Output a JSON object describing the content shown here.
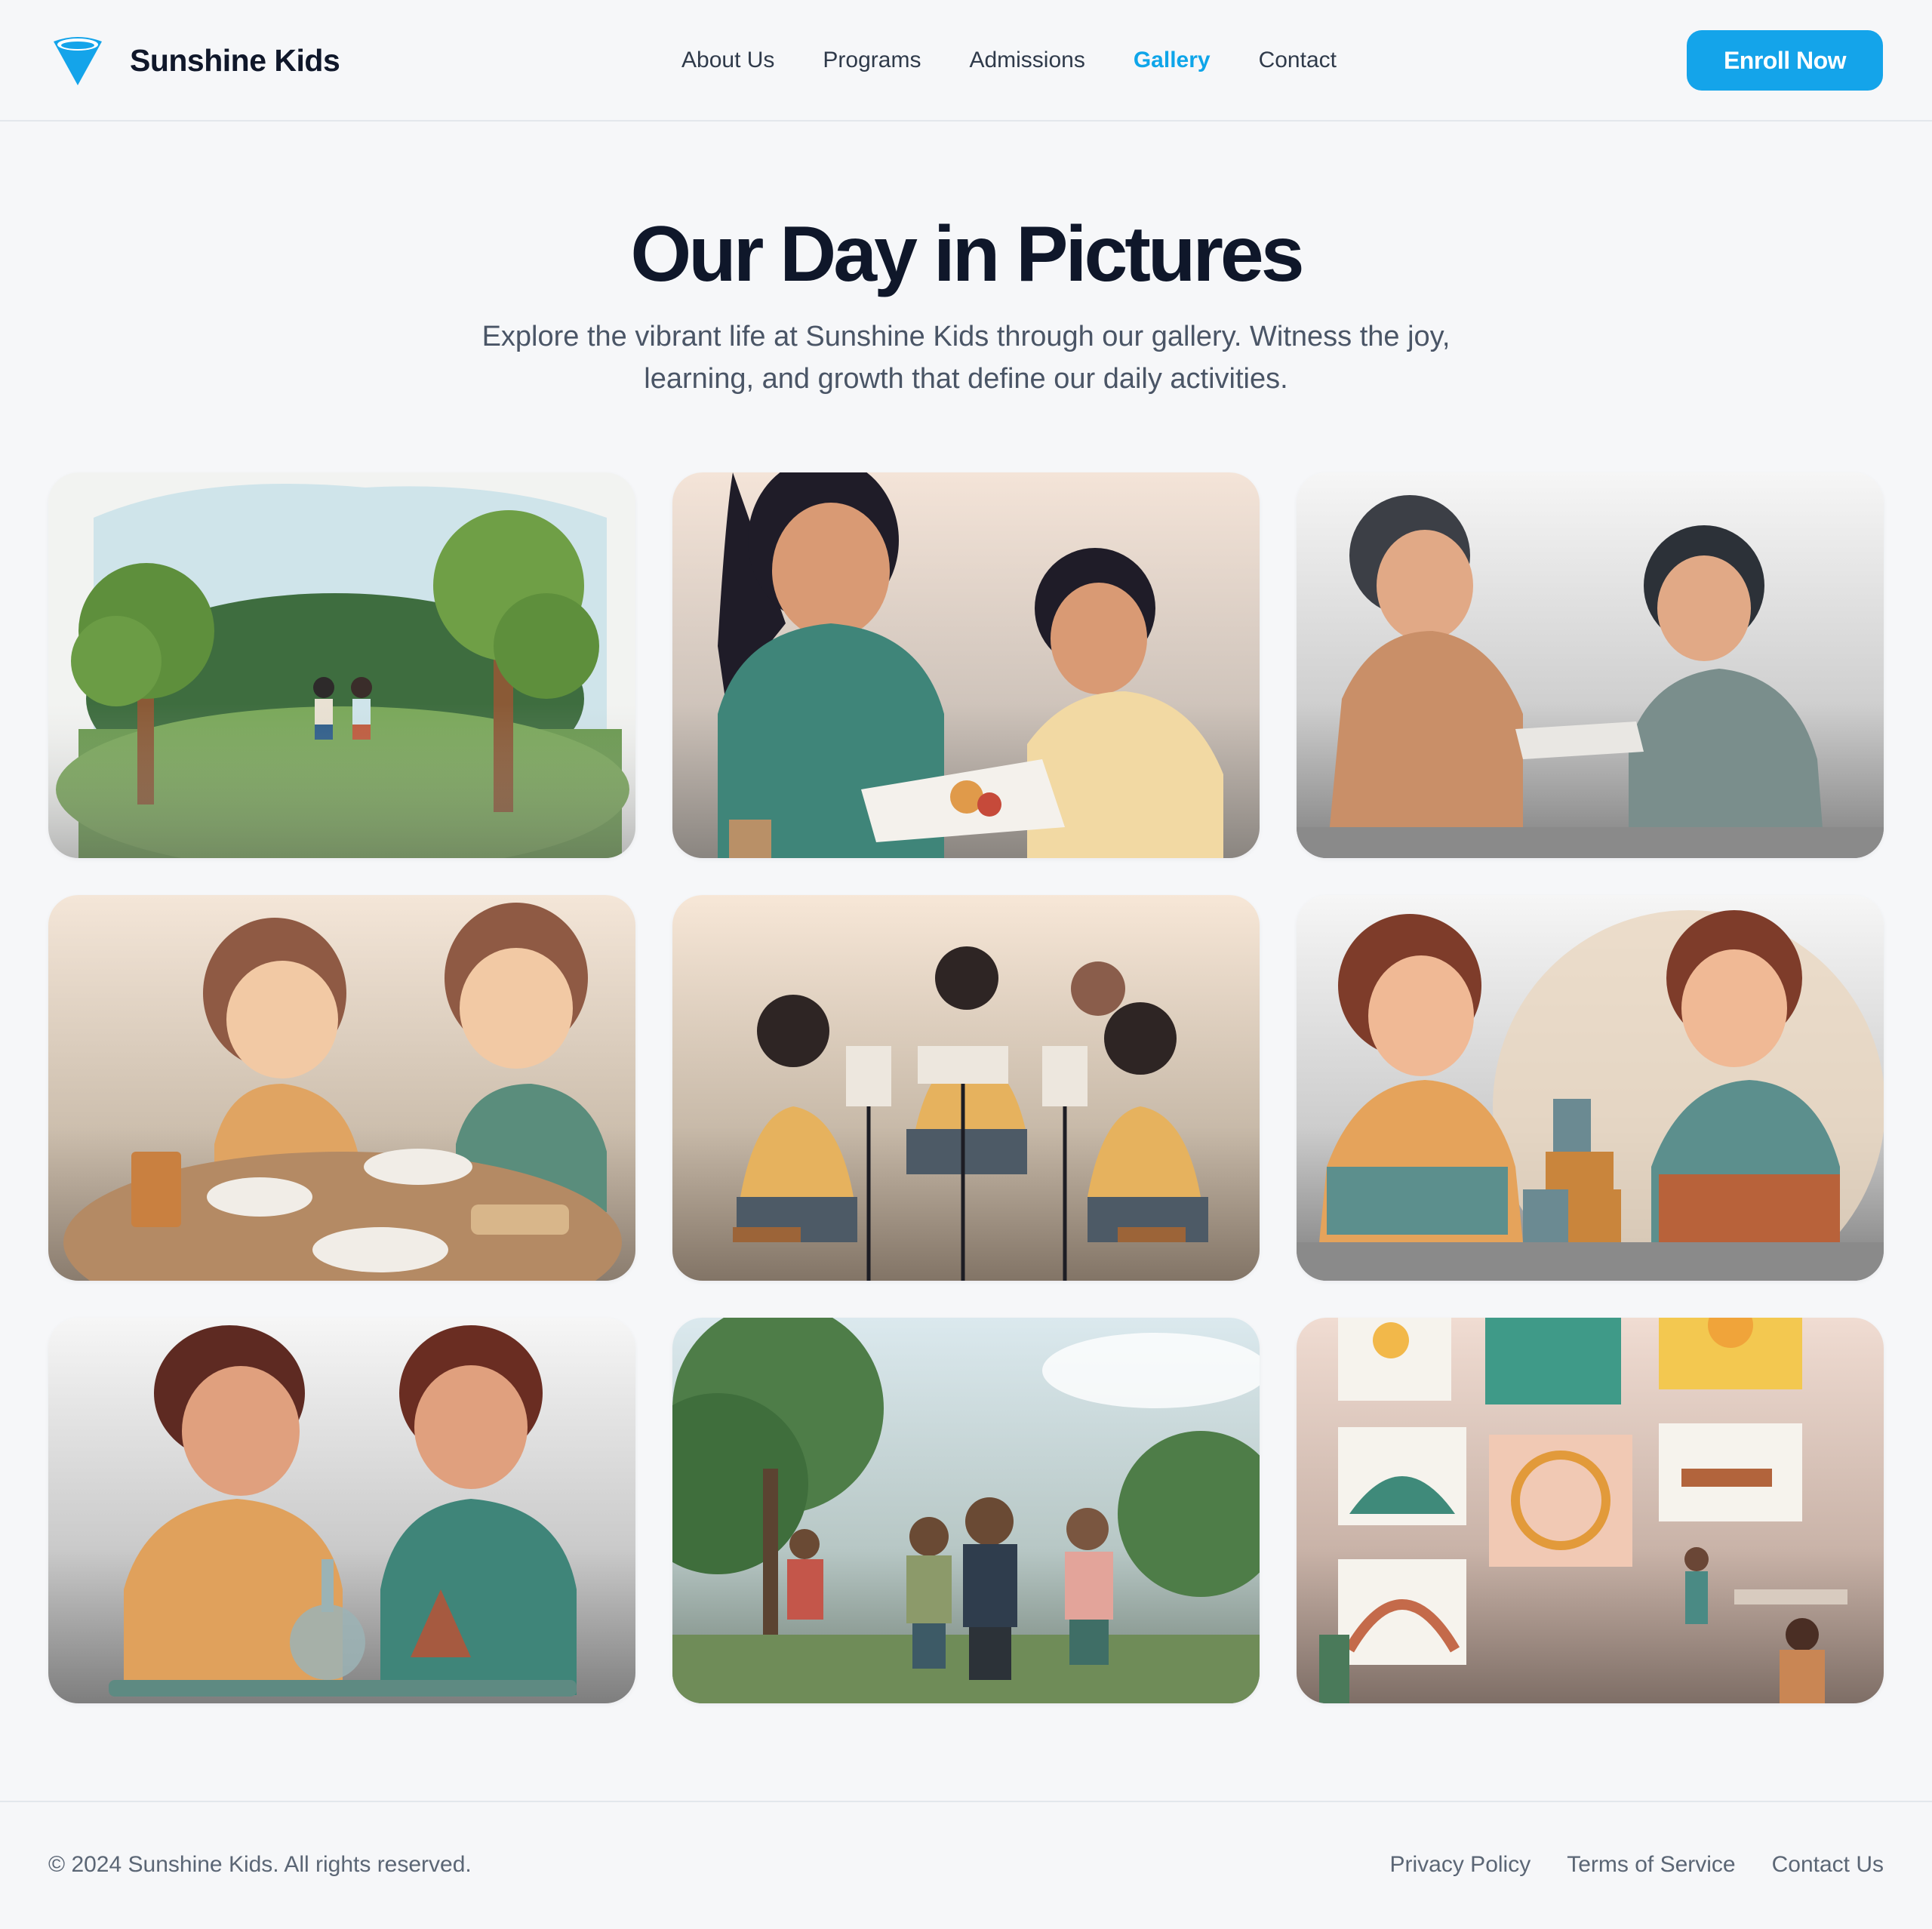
{
  "brand": {
    "name": "Sunshine Kids",
    "logo_icon": "funnel-logo-icon",
    "accent": "#14a4ea"
  },
  "nav": {
    "items": [
      {
        "label": "About Us",
        "active": false
      },
      {
        "label": "Programs",
        "active": false
      },
      {
        "label": "Admissions",
        "active": false
      },
      {
        "label": "Gallery",
        "active": true
      },
      {
        "label": "Contact",
        "active": false
      }
    ],
    "cta_label": "Enroll Now"
  },
  "hero": {
    "title": "Our Day in Pictures",
    "subtitle_line1": "Explore the vibrant life at Sunshine Kids through our gallery. Witness the joy,",
    "subtitle_line2": "learning, and growth that define our daily activities."
  },
  "gallery": {
    "images": [
      {
        "scene": "two children playing in a park with trees"
      },
      {
        "scene": "two girls painting at a table"
      },
      {
        "scene": "two children sitting and sharing a paper"
      },
      {
        "scene": "two children eating lunch at a table"
      },
      {
        "scene": "three children playing music with stands"
      },
      {
        "scene": "two children building with wooden blocks"
      },
      {
        "scene": "two girls doing a science experiment"
      },
      {
        "scene": "children with backpacks walking in a park"
      },
      {
        "scene": "wall of children's art with kids painting"
      }
    ]
  },
  "footer": {
    "copyright": "© 2024 Sunshine Kids. All rights reserved.",
    "links": [
      "Privacy Policy",
      "Terms of Service",
      "Contact Us"
    ]
  }
}
